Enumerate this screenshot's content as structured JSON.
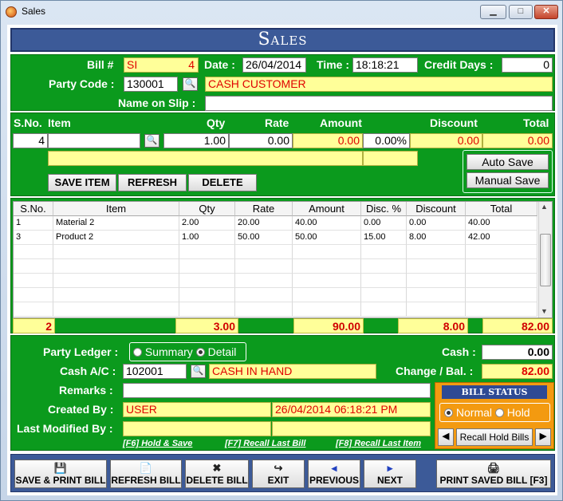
{
  "window": {
    "title": "Sales",
    "minimize": "▁",
    "maximize": "□",
    "close": "✕"
  },
  "header": "Sales",
  "bill": {
    "bill_label": "Bill #",
    "bill_prefix": "SI",
    "bill_no": "4",
    "date_label": "Date :",
    "date": "26/04/2014",
    "time_label": "Time :",
    "time": "18:18:21",
    "credit_days_label": "Credit Days :",
    "credit_days": "0",
    "party_code_label": "Party Code :",
    "party_code": "130001",
    "party_name": "CASH CUSTOMER",
    "name_on_slip_label": "Name on Slip :",
    "name_on_slip": ""
  },
  "entry": {
    "headers": {
      "sno": "S.No.",
      "item": "Item",
      "qty": "Qty",
      "rate": "Rate",
      "amount": "Amount",
      "discount": "Discount",
      "total": "Total"
    },
    "sno": "4",
    "item": "",
    "qty": "1.00",
    "rate": "0.00",
    "amount": "0.00",
    "disc_pct": "0.00%",
    "discount": "0.00",
    "total": "0.00",
    "save_item": "SAVE ITEM",
    "refresh": "REFRESH",
    "delete": "DELETE",
    "auto_save": "Auto Save",
    "manual_save": "Manual Save"
  },
  "grid": {
    "columns": [
      "S.No.",
      "Item",
      "Qty",
      "Rate",
      "Amount",
      "Disc. %",
      "Discount",
      "Total"
    ],
    "rows": [
      [
        "1",
        "Material 2",
        "2.00",
        "20.00",
        "40.00",
        "0.00",
        "0.00",
        "40.00"
      ],
      [
        "3",
        "Product 2",
        "1.00",
        "50.00",
        "50.00",
        "15.00",
        "8.00",
        "42.00"
      ]
    ],
    "totals": {
      "count": "2",
      "qty": "3.00",
      "amount": "90.00",
      "discount": "8.00",
      "total": "82.00"
    }
  },
  "footer": {
    "party_ledger_label": "Party Ledger :",
    "summary": "Summary",
    "detail": "Detail",
    "cash_label": "Cash :",
    "cash": "0.00",
    "cash_ac_label": "Cash A/C :",
    "cash_ac_code": "102001",
    "cash_ac_name": "CASH IN HAND",
    "change_label": "Change / Bal. :",
    "change": "82.00",
    "remarks_label": "Remarks :",
    "remarks": "",
    "created_by_label": "Created By :",
    "created_by": "USER",
    "created_at": "26/04/2014 06:18:21 PM",
    "last_modified_label": "Last Modified By :",
    "last_modified_by": "",
    "last_modified_at": "",
    "hotkey_f6": "[F6] Hold & Save",
    "hotkey_f7": "[F7] Recall Last Bill",
    "hotkey_f8": "[F8] Recall Last Item",
    "bill_status_title": "BILL STATUS",
    "status_normal": "Normal",
    "status_hold": "Hold",
    "recall_hold": "Recall Hold Bills",
    "prev_arrow": "◀",
    "next_arrow": "▶"
  },
  "buttons": {
    "save_print": "SAVE & PRINT BILL",
    "refresh_bill": "REFRESH BILL",
    "delete_bill": "DELETE BILL",
    "exit": "EXIT",
    "previous": "PREVIOUS",
    "next": "NEXT",
    "print_saved": "PRINT SAVED BILL [F3]"
  },
  "colors": {
    "panel_green": "#0b9a1d",
    "header_blue": "#3c5a98",
    "field_yellow": "#ffff99",
    "value_red": "#e00000",
    "status_orange": "#f39a10"
  }
}
